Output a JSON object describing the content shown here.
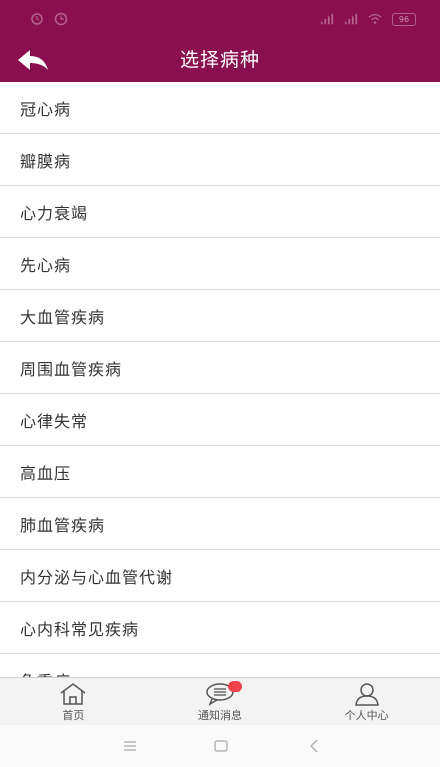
{
  "header": {
    "title": "选择病种",
    "background": "#8a0f4e",
    "status_bar": {
      "battery": "96",
      "left_icons": [
        "alarm-icon",
        "clock-icon"
      ],
      "right_icons": [
        "signal-icon",
        "signal-icon",
        "wifi-icon",
        "battery-icon"
      ]
    },
    "back_icon": "back-arrow-icon"
  },
  "diseases": [
    "冠心病",
    "瓣膜病",
    "心力衰竭",
    "先心病",
    "大血管疾病",
    "周围血管疾病",
    "心律失常",
    "高血压",
    "肺血管疾病",
    "内分泌与心血管代谢",
    "心内科常见疾病",
    "危重症"
  ],
  "tabbar": {
    "tabs": [
      {
        "label": "首页",
        "icon": "home-icon"
      },
      {
        "label": "通知消息",
        "icon": "message-icon",
        "has_badge": true
      },
      {
        "label": "个人中心",
        "icon": "user-icon"
      }
    ],
    "badge_color": "#f0424d"
  },
  "system_nav": {
    "buttons": [
      "menu-icon",
      "home-square-icon",
      "back-chevron-icon"
    ]
  }
}
